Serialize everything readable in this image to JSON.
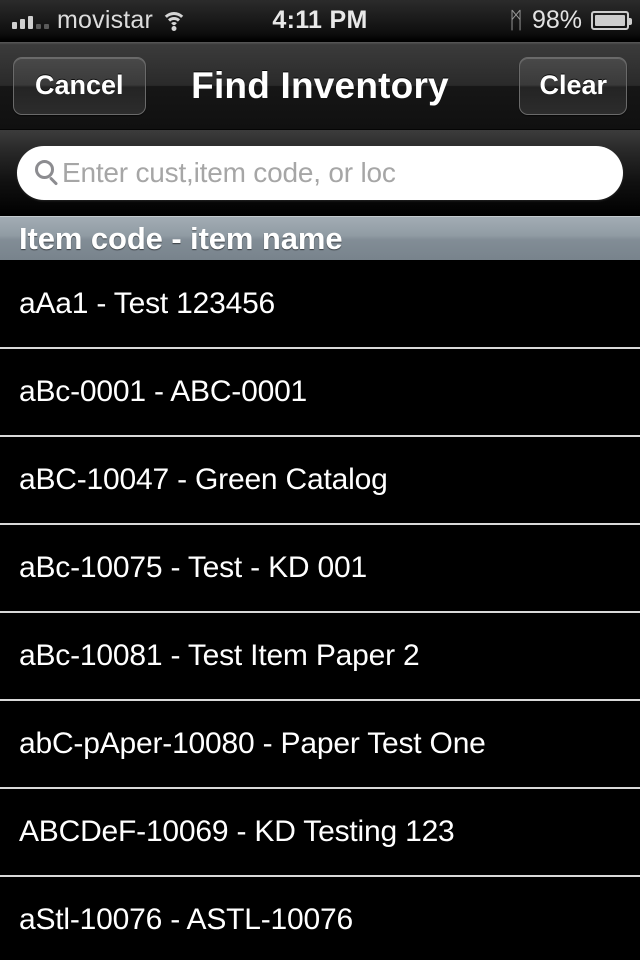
{
  "status_bar": {
    "carrier": "movistar",
    "time": "4:11 PM",
    "battery_percent": "98%",
    "signal_icon": "signal-bars-icon",
    "wifi_icon": "wifi-icon",
    "bluetooth_icon": "bluetooth-icon",
    "bluetooth_glyph": "ᛗ",
    "battery_icon": "battery-icon"
  },
  "nav_bar": {
    "title": "Find Inventory",
    "left_button": "Cancel",
    "right_button": "Clear"
  },
  "search": {
    "value": "",
    "placeholder": "Enter cust,item code, or loc",
    "icon": "search-icon"
  },
  "section_header": {
    "label": "Item code - item name"
  },
  "list": {
    "items": [
      {
        "label": "aAa1 - Test 123456"
      },
      {
        "label": "aBc-0001 - ABC-0001"
      },
      {
        "label": "aBC-10047 - Green Catalog"
      },
      {
        "label": "aBc-10075 - Test - KD 001"
      },
      {
        "label": "aBc-10081 - Test Item Paper 2"
      },
      {
        "label": "abC-pAper-10080 - Paper Test One"
      },
      {
        "label": "ABCDeF-10069 - KD Testing 123"
      },
      {
        "label": "aStl-10076 - ASTL-10076"
      }
    ]
  },
  "colors": {
    "background": "#000000",
    "row_text": "#ffffff",
    "separator": "#d9d9d9",
    "section_header_top": "#a2acb4",
    "section_header_bottom": "#78838c",
    "placeholder_text": "#a6a6a6",
    "status_text": "#e2e2e2"
  }
}
